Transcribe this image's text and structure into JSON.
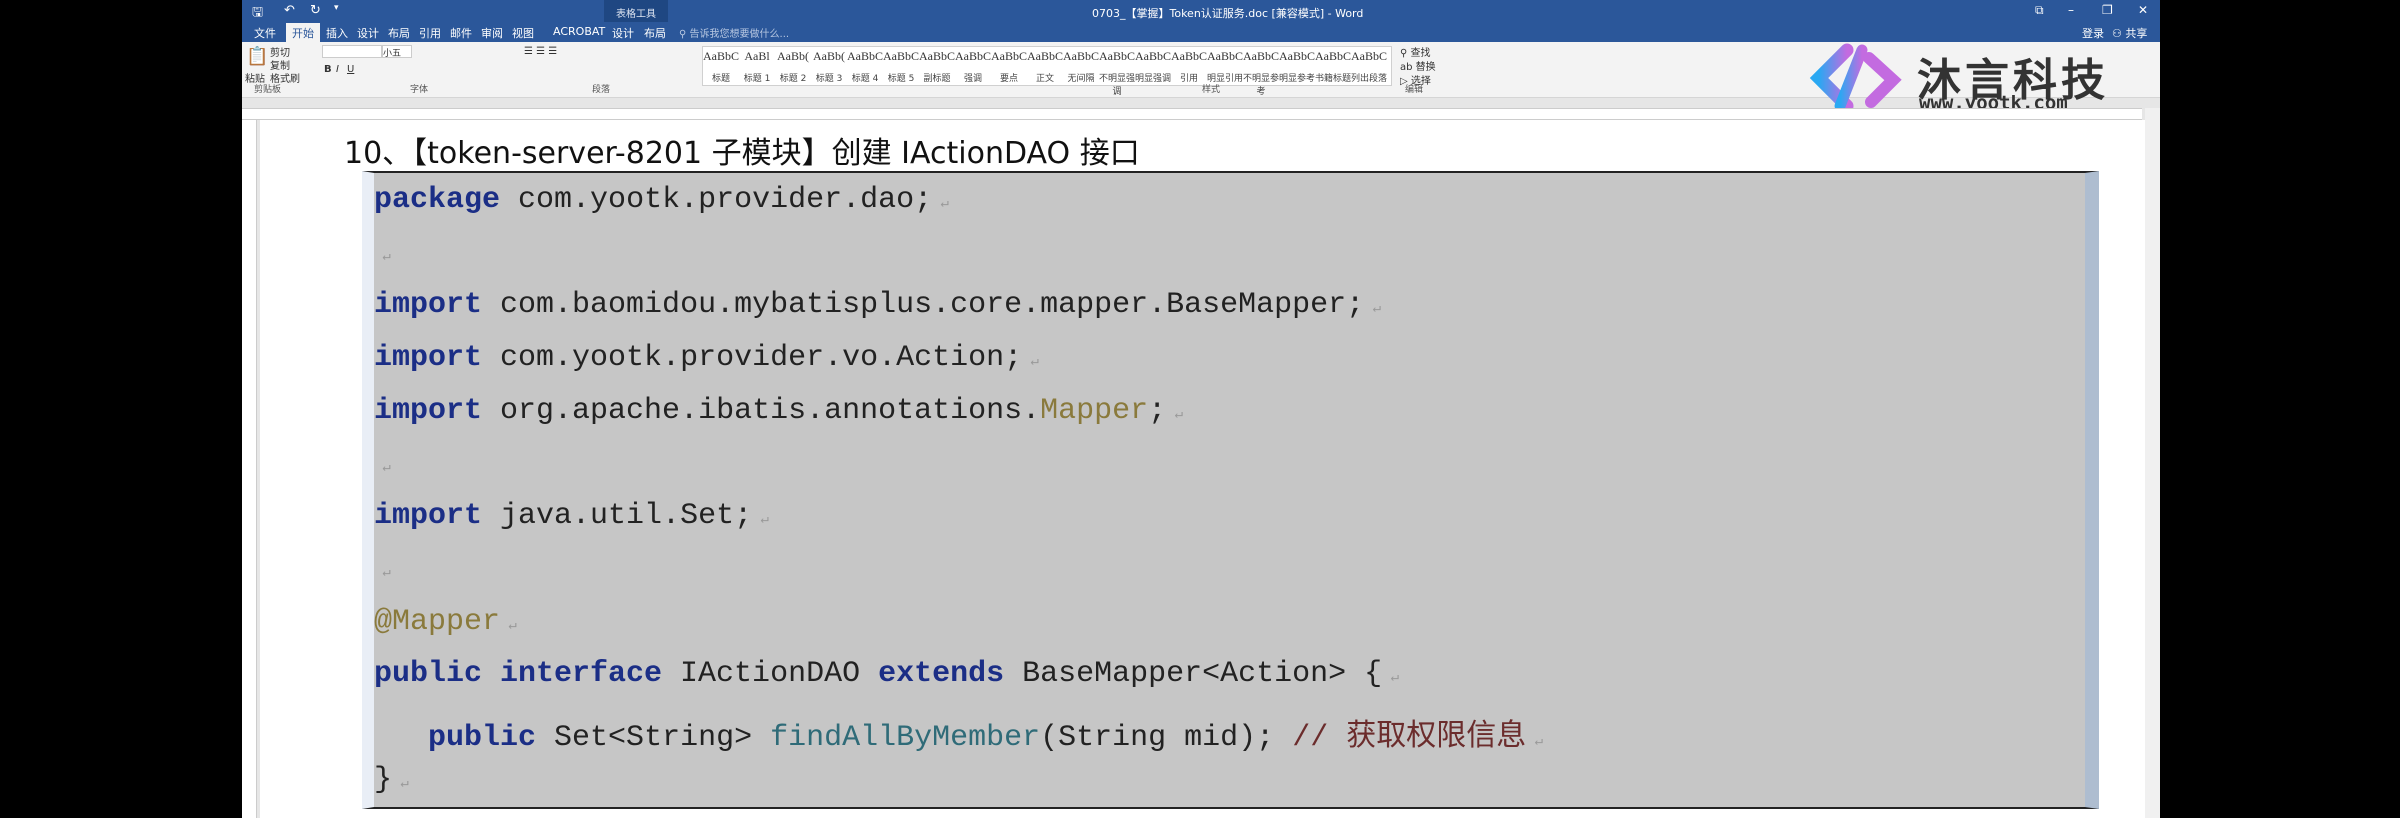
{
  "window": {
    "title": "0703_【掌握】Token认证服务.doc [兼容模式] - Word",
    "context_tab": "表格工具",
    "login": "登录",
    "share": "共享"
  },
  "tabs": [
    "文件",
    "开始",
    "插入",
    "设计",
    "布局",
    "引用",
    "邮件",
    "审阅",
    "视图",
    "ACROBAT",
    "设计",
    "布局"
  ],
  "tell_me": "告诉我您想要做什么...",
  "ribbon": {
    "clipboard": {
      "paste": "粘贴",
      "cut": "剪切",
      "copy": "复制",
      "format_painter": "格式刷",
      "label": "剪贴板"
    },
    "font": {
      "size": "小五",
      "label": "字体"
    },
    "paragraph": {
      "label": "段落"
    },
    "styles": {
      "label": "样式",
      "items": [
        {
          "preview": "AaBbC",
          "name": "标题"
        },
        {
          "preview": "AaBl",
          "name": "标题 1"
        },
        {
          "preview": "AaBb(",
          "name": "标题 2"
        },
        {
          "preview": "AaBb(",
          "name": "标题 3"
        },
        {
          "preview": "AaBbCc",
          "name": "标题 4"
        },
        {
          "preview": "AaBbC",
          "name": "标题 5"
        },
        {
          "preview": "AaBbC",
          "name": "副标题"
        },
        {
          "preview": "AaBbCcDc",
          "name": "强调"
        },
        {
          "preview": "AaBbCcD",
          "name": "要点"
        },
        {
          "preview": "AaBbCcDc",
          "name": "正文"
        },
        {
          "preview": "AaBbCcDc",
          "name": "无间隔"
        },
        {
          "preview": "AaBbCcDc",
          "name": "不明显强调"
        },
        {
          "preview": "AaBbCcDc",
          "name": "明显强调"
        },
        {
          "preview": "AaBbCcDc",
          "name": "引用"
        },
        {
          "preview": "AaBbCcDc",
          "name": "明显引用"
        },
        {
          "preview": "AaBbCcD",
          "name": "不明显参考"
        },
        {
          "preview": "AaBbCcI",
          "name": "明显参考"
        },
        {
          "preview": "AaBbCcD",
          "name": "书籍标题"
        },
        {
          "preview": "AaBbCcDc",
          "name": "列出段落"
        }
      ]
    },
    "editing": {
      "find": "查找",
      "replace": "替换",
      "select": "选择",
      "label": "编辑"
    }
  },
  "logo": {
    "name": "沐言科技",
    "url": "www.yootk.com"
  },
  "document": {
    "heading": "10、【token-server-8201 子模块】创建 IActionDAO 接口",
    "code": [
      [
        [
          "kw",
          "package"
        ],
        [
          "",
          "com.yootk.provider.dao;"
        ]
      ],
      [],
      [
        [
          "kw",
          "import"
        ],
        [
          "",
          " com.baomidou.mybatisplus.core.mapper.BaseMapper;"
        ]
      ],
      [
        [
          "kw",
          "import"
        ],
        [
          "",
          " com.yootk.provider.vo.Action;"
        ]
      ],
      [
        [
          "kw",
          "import"
        ],
        [
          "",
          " org.apache.ibatis.annotations."
        ],
        [
          "ann",
          "Mapper"
        ],
        [
          "",
          ";"
        ]
      ],
      [],
      [
        [
          "kw",
          "import"
        ],
        [
          "",
          " java.util.Set;"
        ]
      ],
      [],
      [
        [
          "ann",
          "@Mapper"
        ]
      ],
      [
        [
          "kw",
          "public interface"
        ],
        [
          "",
          " IActionDAO "
        ],
        [
          "kw",
          "extends"
        ],
        [
          "",
          " BaseMapper<Action> {"
        ]
      ],
      [
        [
          "",
          "   "
        ],
        [
          "kw",
          "public"
        ],
        [
          "",
          " Set<String> "
        ],
        [
          "meth",
          "findAllByMember"
        ],
        [
          "",
          "(String mid); "
        ],
        [
          "cm",
          "// 获取权限信息"
        ]
      ],
      [
        [
          "",
          "}"
        ]
      ]
    ]
  }
}
